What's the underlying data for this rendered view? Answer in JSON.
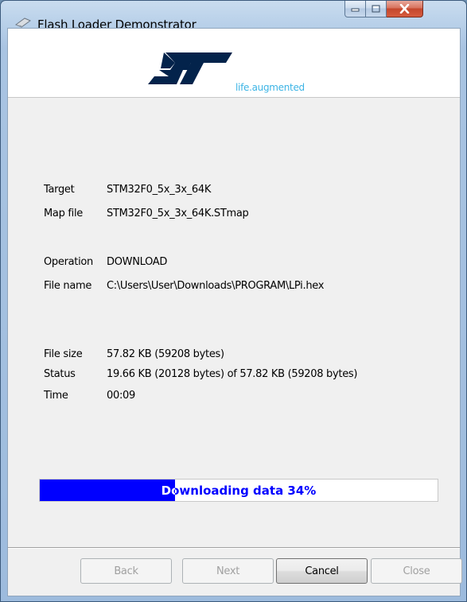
{
  "window": {
    "title": "Flash Loader Demonstrator"
  },
  "banner": {
    "tagline": "life.augmented",
    "logo_icon": "st-logo-icon"
  },
  "info": {
    "target_label": "Target",
    "target_value": "STM32F0_5x_3x_64K",
    "mapfile_label": "Map file",
    "mapfile_value": "STM32F0_5x_3x_64K.STmap",
    "operation_label": "Operation",
    "operation_value": "DOWNLOAD",
    "filename_label": "File name",
    "filename_value": "C:\\Users\\User\\Downloads\\PROGRAM\\LPi.hex",
    "filesize_label": "File size",
    "filesize_value": "57.82 KB (59208 bytes)",
    "status_label": "Status",
    "status_value": "19.66 KB (20128 bytes) of 57.82 KB (59208 bytes)",
    "time_label": "Time",
    "time_value": "00:09"
  },
  "progress": {
    "text": "Downloading data 34%",
    "fraction": 0.34
  },
  "buttons": {
    "back": "Back",
    "next": "Next",
    "cancel": "Cancel",
    "close": "Close"
  },
  "colors": {
    "progress_fill": "#0000ff",
    "tagline": "#3cb4e5",
    "logo": "#03234b"
  }
}
